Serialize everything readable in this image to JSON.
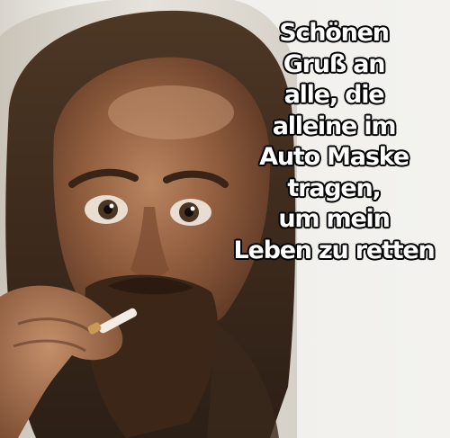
{
  "meme": {
    "caption_lines": [
      "Schönen",
      "Gruß an",
      "alle, die",
      "alleine im",
      "Auto Maske",
      "tragen,",
      "um mein",
      "Leben zu retten"
    ]
  },
  "colors": {
    "caption_text": "#ffffff",
    "caption_outline": "#000000",
    "background": "#efeeea"
  }
}
